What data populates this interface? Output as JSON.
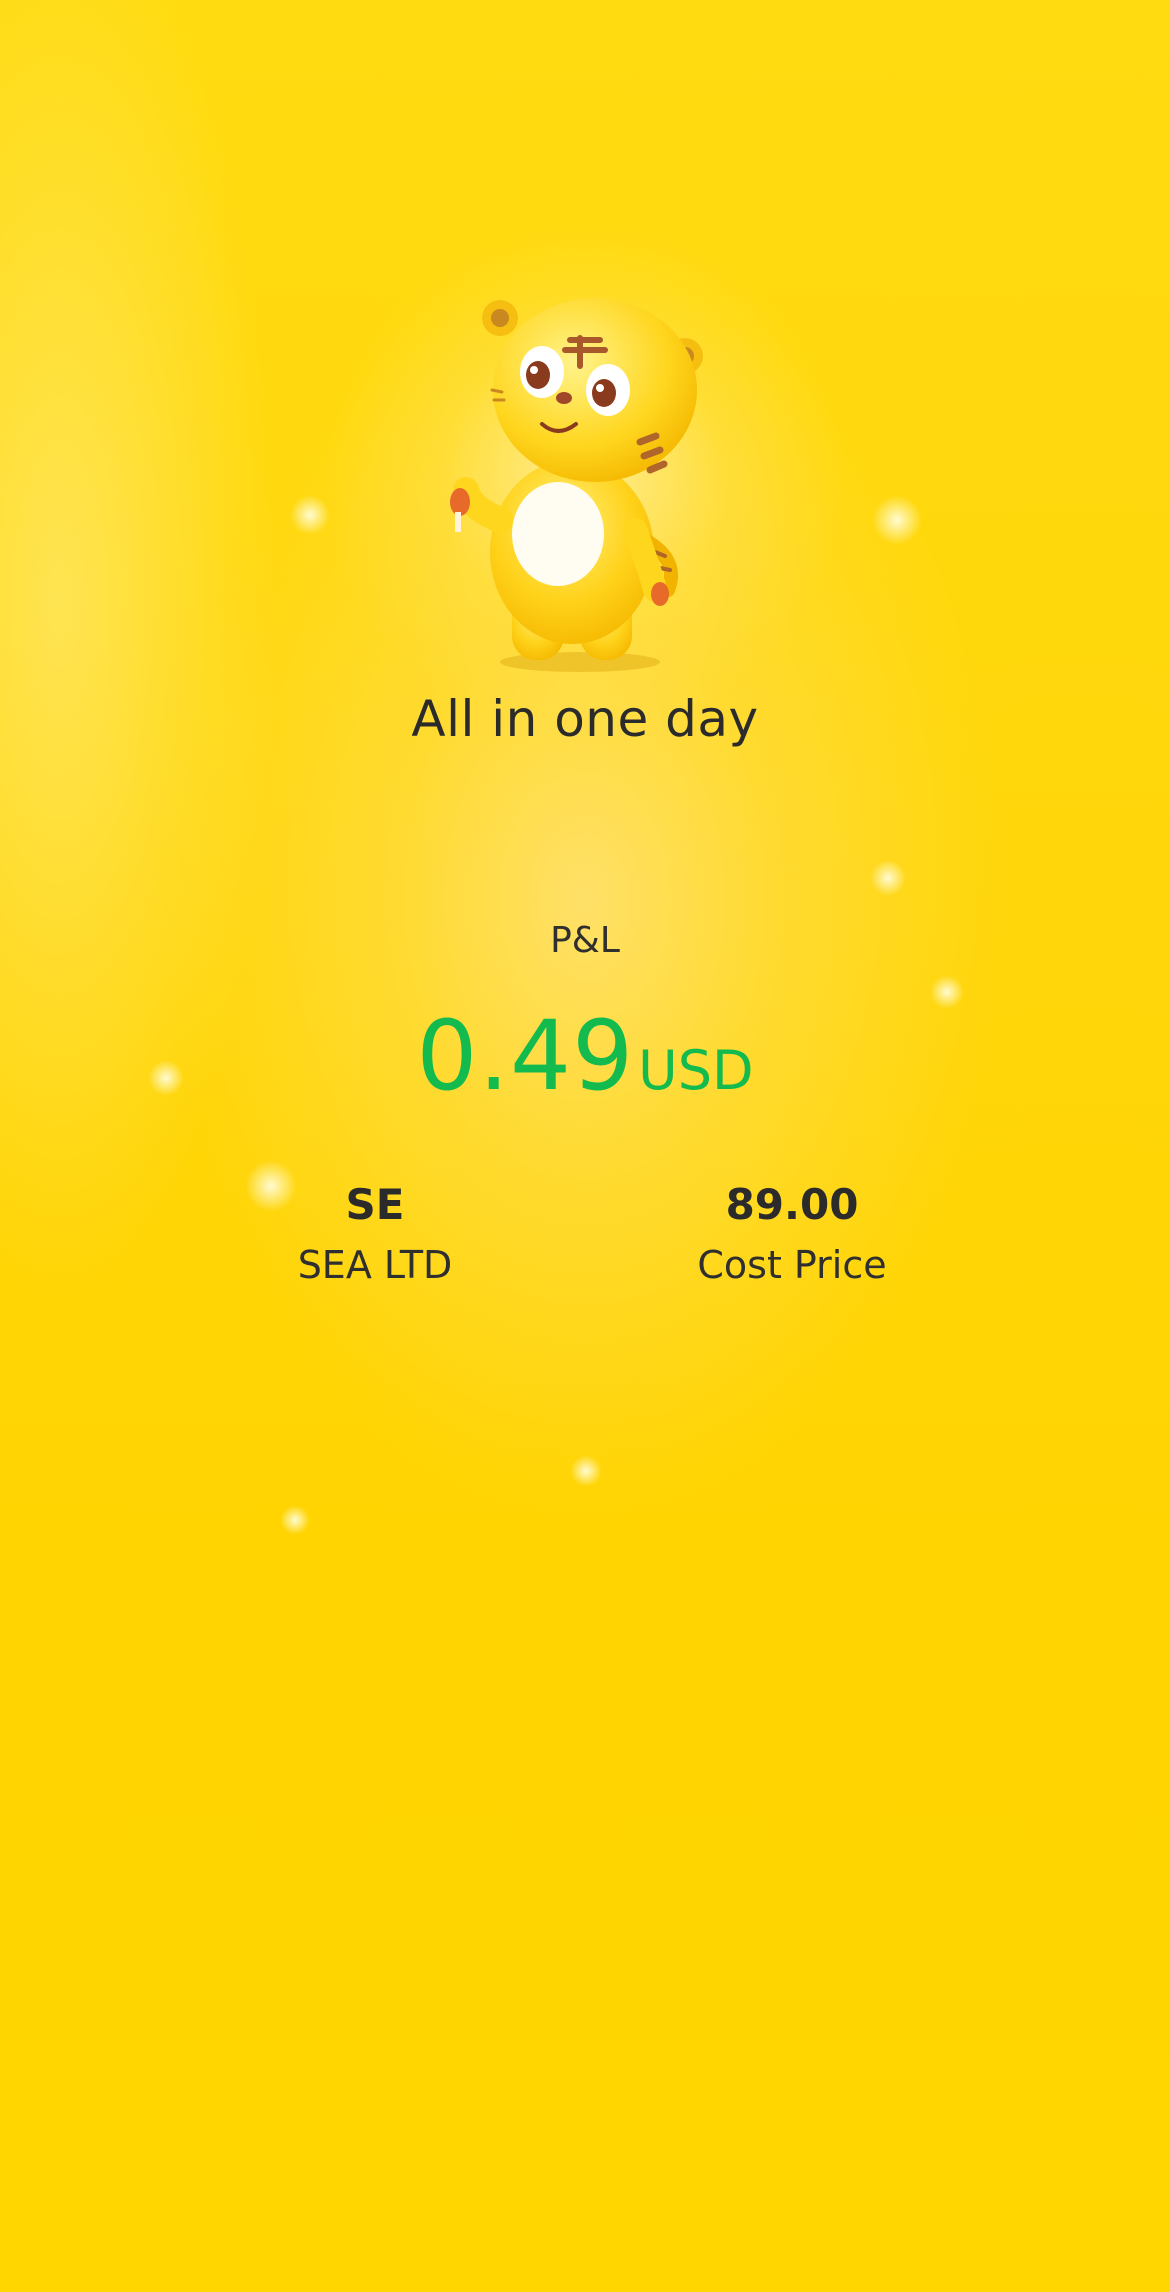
{
  "hero": {
    "title": "All in one day"
  },
  "pnl": {
    "label": "P&L",
    "amount": "0.49",
    "currency": "USD",
    "color": "#13BA4E"
  },
  "stock": {
    "ticker": "SE",
    "name": "SEA LTD"
  },
  "cost": {
    "value": "89.00",
    "label": "Cost Price"
  },
  "theme": {
    "background": "#FFD800",
    "text": "#2B2B2B"
  },
  "icons": {
    "mascot": "tiger-mascot-icon"
  }
}
